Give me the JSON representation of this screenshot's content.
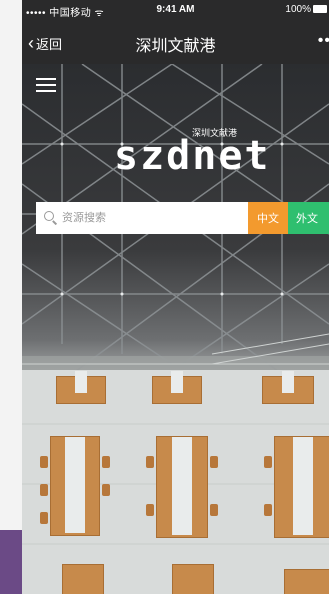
{
  "status_bar": {
    "carrier": "••••• 中国移动  ᯤ",
    "time": "9:41 AM",
    "battery": "100%"
  },
  "nav": {
    "back_label": "返回",
    "title": "深圳文献港",
    "more": "••"
  },
  "hero": {
    "logo_text": "szdnet",
    "logo_badge": "深圳文献港",
    "search": {
      "placeholder": "资源搜索",
      "chinese_button": "中文",
      "foreign_button": "外文"
    }
  },
  "colors": {
    "nav_bg": "#2a2a2b",
    "chinese_button": "#f39a2e",
    "foreign_button": "#2fbf6f",
    "purple_edge": "#6b4a86"
  }
}
